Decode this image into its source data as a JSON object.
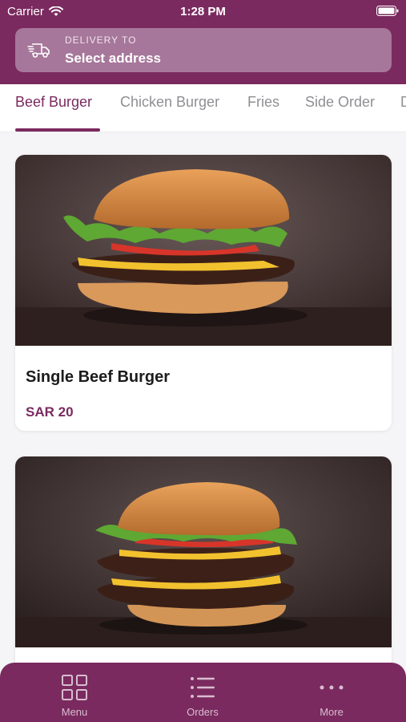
{
  "status_bar": {
    "carrier": "Carrier",
    "time": "1:28 PM"
  },
  "delivery": {
    "caption": "DELIVERY TO",
    "value": "Select address"
  },
  "tabs": [
    {
      "label": "Beef Burger",
      "active": true
    },
    {
      "label": "Chicken Burger",
      "active": false
    },
    {
      "label": "Fries",
      "active": false
    },
    {
      "label": "Side Order",
      "active": false
    },
    {
      "label": "D",
      "active": false
    }
  ],
  "products": [
    {
      "name": "Single Beef Burger",
      "price": "SAR 20",
      "image": "single-beef-burger-photo"
    },
    {
      "name": "",
      "price": "",
      "image": "double-beef-burger-photo"
    }
  ],
  "bottom_nav": [
    {
      "label": "Menu",
      "icon": "grid-icon"
    },
    {
      "label": "Orders",
      "icon": "list-icon"
    },
    {
      "label": "More",
      "icon": "more-icon"
    }
  ],
  "colors": {
    "brand": "#7a2a5f",
    "address_bar": "#a6779a",
    "tab_inactive": "#8f8f94",
    "background": "#f5f4f6"
  }
}
